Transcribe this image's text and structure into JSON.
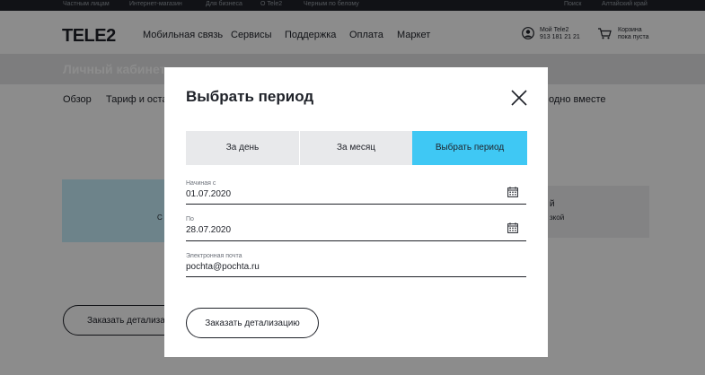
{
  "topbar": {
    "items": [
      "Частным лицам",
      "Интернет-магазин",
      "Для бизнеса",
      "О Tele2",
      "Черным по белому"
    ],
    "search": "Поиск",
    "region": "Алтайский край"
  },
  "header": {
    "logo": "TELE2",
    "nav": [
      "Мобильная связь",
      "Сервисы",
      "Поддержка",
      "Оплата",
      "Маркет"
    ],
    "account_title": "Мой Tele2",
    "account_number": "913 181 21 21",
    "cart_title": "Корзина",
    "cart_status": "пока пуста",
    "icons": [
      "user-icon",
      "cart-icon"
    ]
  },
  "page": {
    "title": "Личный кабинет",
    "subnav": [
      "Обзор",
      "Тариф и остатки",
      "одно вместе"
    ],
    "card_text": "С",
    "card2_title": "й",
    "card2_sub": "зкой",
    "order_button": "Заказать детализацию"
  },
  "modal": {
    "title": "Выбрать период",
    "tabs": [
      {
        "label": "За день",
        "active": false
      },
      {
        "label": "За месяц",
        "active": false
      },
      {
        "label": "Выбрать период",
        "active": true
      }
    ],
    "fields": [
      {
        "label": "Начиная с",
        "value": "01.07.2020",
        "icon": "calendar-icon"
      },
      {
        "label": "По",
        "value": "28.07.2020",
        "icon": "calendar-icon"
      },
      {
        "label": "Электронная почта",
        "value": "pochta@pochta.ru"
      }
    ],
    "submit": "Заказать детализацию",
    "close_icon": "close-icon"
  },
  "colors": {
    "accent": "#3fc8f4",
    "dark": "#1f2229",
    "overlay": "rgba(0,0,0,0.45)"
  }
}
